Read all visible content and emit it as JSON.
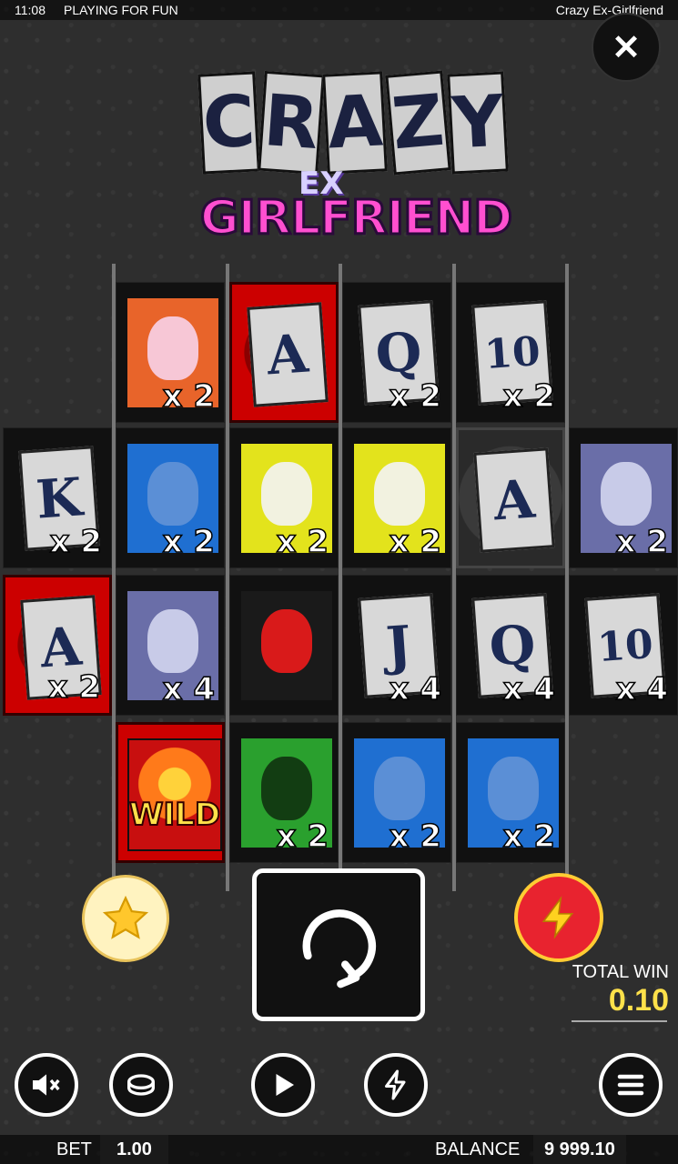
{
  "status_bar": {
    "time": "11:08",
    "mode": "PLAYING FOR FUN",
    "game_name": "Crazy Ex-Girlfriend"
  },
  "logo": {
    "line1": "CRAZY",
    "line2": "EX",
    "line3": "GIRLFRIEND"
  },
  "reels": [
    {
      "col": 1,
      "row": 0,
      "symbol": "bunny",
      "mult": "x 2"
    },
    {
      "col": 2,
      "row": 0,
      "symbol": "A",
      "mult": "",
      "style": "red"
    },
    {
      "col": 3,
      "row": 0,
      "symbol": "Q",
      "mult": "x 2"
    },
    {
      "col": 4,
      "row": 0,
      "symbol": "10",
      "mult": "x 2"
    },
    {
      "col": 0,
      "row": 1,
      "symbol": "K",
      "mult": "x 2"
    },
    {
      "col": 1,
      "row": 1,
      "symbol": "blue-man",
      "mult": "x 2"
    },
    {
      "col": 2,
      "row": 1,
      "symbol": "clown-woman",
      "mult": "x 2"
    },
    {
      "col": 3,
      "row": 1,
      "symbol": "clown-woman",
      "mult": "x 2"
    },
    {
      "col": 4,
      "row": 1,
      "symbol": "A",
      "mult": "",
      "style": "grey"
    },
    {
      "col": 5,
      "row": 1,
      "symbol": "poison",
      "mult": "x 2"
    },
    {
      "col": 0,
      "row": 2,
      "symbol": "A",
      "mult": "x 2",
      "style": "red"
    },
    {
      "col": 1,
      "row": 2,
      "symbol": "poison",
      "mult": "x 4"
    },
    {
      "col": 2,
      "row": 2,
      "symbol": "scissors",
      "mult": ""
    },
    {
      "col": 3,
      "row": 2,
      "symbol": "J",
      "mult": "x 4"
    },
    {
      "col": 4,
      "row": 2,
      "symbol": "Q",
      "mult": "x 4"
    },
    {
      "col": 5,
      "row": 2,
      "symbol": "10",
      "mult": "x 4"
    },
    {
      "col": 1,
      "row": 3,
      "symbol": "WILD",
      "mult": "",
      "style": "red"
    },
    {
      "col": 2,
      "row": 3,
      "symbol": "green-monster",
      "mult": "x 2"
    },
    {
      "col": 3,
      "row": 3,
      "symbol": "blue-man",
      "mult": "x 2"
    },
    {
      "col": 4,
      "row": 3,
      "symbol": "blue-man",
      "mult": "x 2"
    }
  ],
  "total_win": {
    "label": "TOTAL WIN",
    "value": "0.10"
  },
  "bet": {
    "label": "BET",
    "value": "1.00"
  },
  "balance": {
    "label": "BALANCE",
    "value": "9 999.10"
  },
  "colors": {
    "accent_yellow": "#ffe14a",
    "red": "#e8232f",
    "pink": "#ff4fd0"
  }
}
